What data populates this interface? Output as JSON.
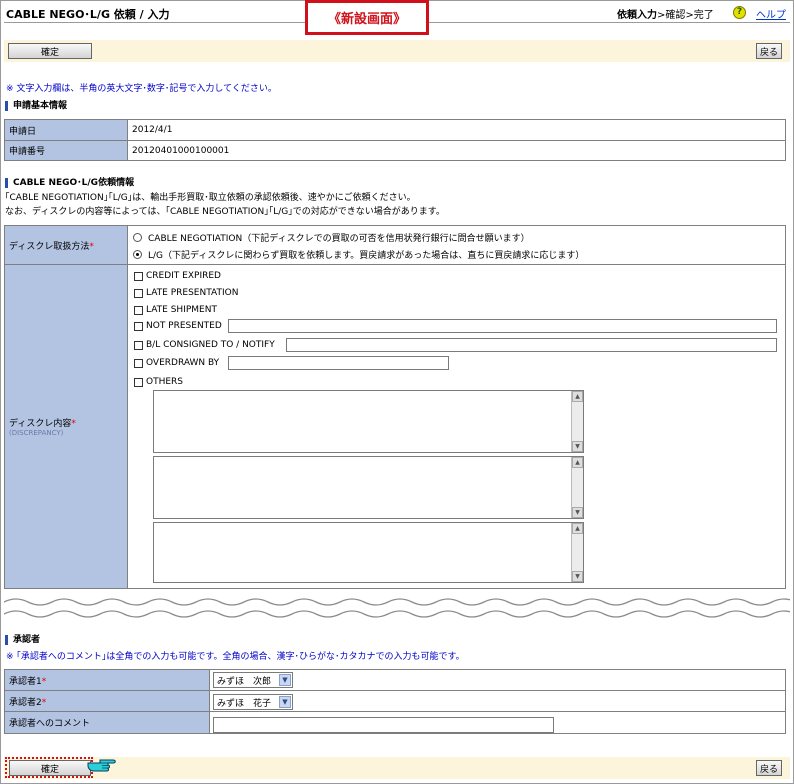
{
  "header": {
    "title": "CABLE NEGO･L/G 依頼 / 入力",
    "new_screen_label": "《新設画面》",
    "steps_current": "依頼入力",
    "steps_rest": ">確認>完了",
    "help_label": "ヘルプ"
  },
  "toolbar": {
    "confirm_label": "確定",
    "back_label": "戻る"
  },
  "notice": "※ 文字入力欄は、半角の英大文字･数字･記号で入力してください。",
  "basic_info": {
    "section_title": "申請基本情報",
    "rows": [
      {
        "label": "申請日",
        "value": "2012/4/1"
      },
      {
        "label": "申請番号",
        "value": "20120401000100001"
      }
    ]
  },
  "lg_section": {
    "title": "CABLE NEGO･L/G依頼情報",
    "desc1": "｢CABLE NEGOTIATION｣｢L/G｣は、輸出手形買取･取立依頼の承認依頼後、速やかにご依頼ください。",
    "desc2": "なお、ディスクレの内容等によっては、｢CABLE NEGOTIATION｣｢L/G｣での対応ができない場合があります。",
    "method_label": "ディスクレ取扱方法",
    "required_mark": "*",
    "options": [
      {
        "text": "CABLE NEGOTIATION（下記ディスクレでの買取の可否を信用状発行銀行に問合せ願います）",
        "selected": false
      },
      {
        "text": "L/G（下記ディスクレに関わらず買取を依頼します。買戻請求があった場合は、直ちに買戻請求に応じます）",
        "selected": true
      }
    ],
    "content_label": "ディスクレ内容",
    "content_sub": "(DISCREPANCY)",
    "checkboxes": [
      "CREDIT EXPIRED",
      "LATE PRESENTATION",
      "LATE SHIPMENT",
      "NOT PRESENTED",
      "B/L CONSIGNED TO / NOTIFY",
      "OVERDRAWN BY",
      "OTHERS"
    ]
  },
  "approver": {
    "section_title": "承認者",
    "note": "※ ｢承認者へのコメント｣は全角での入力も可能です。全角の場合、漢字･ひらがな･カタカナでの入力も可能です。",
    "rows": [
      {
        "label": "承認者1",
        "required": "*",
        "value": "みずほ　次郎"
      },
      {
        "label": "承認者2",
        "required": "*",
        "value": "みずほ　花子"
      },
      {
        "label": "承認者へのコメント",
        "required": "",
        "value": ""
      }
    ]
  },
  "colors": {
    "label_bg": "#b3c3e2",
    "bar_bg": "#fcf5dc",
    "stamp_red": "#d0101a",
    "note_blue": "#0000cc"
  },
  "icons": [
    "help-icon",
    "pointing-hand-icon",
    "scroll-up-arrow-icon",
    "scroll-down-arrow-icon",
    "dropdown-arrow-icon"
  ]
}
